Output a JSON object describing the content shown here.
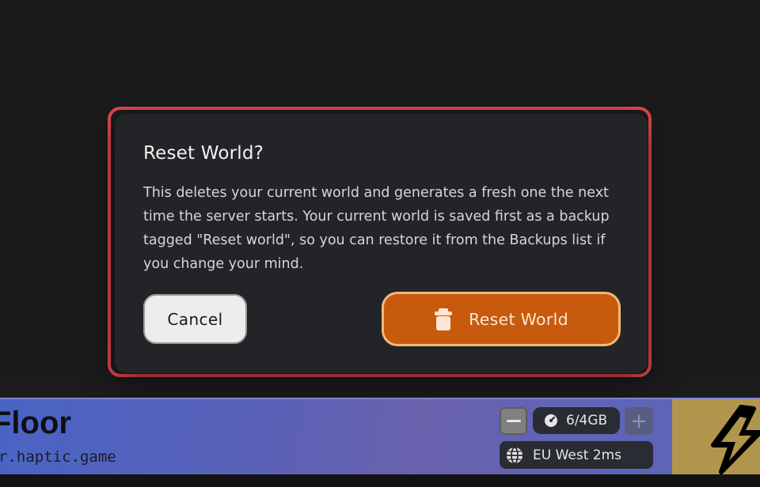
{
  "dialog": {
    "title": "Reset World?",
    "body": "This deletes your current world and generates a fresh one the next time the server starts. Your current world is saved first as a backup tagged \"Reset world\", so you can restore it from the Backups list if you change your mind.",
    "cancel_label": "Cancel",
    "confirm_label": "Reset World",
    "confirm_icon": "trash-icon"
  },
  "server": {
    "title": "Floor",
    "address": "r.haptic.game",
    "memory": "6/4GB",
    "memory_icon": "gauge-icon",
    "region": "EU West 2ms",
    "region_icon": "globe-icon",
    "power_icon": "lightning-icon"
  },
  "colors": {
    "danger_outline": "#e5484d",
    "confirm_button": "#c75a0d",
    "confirm_border": "#f4b77a",
    "power_panel": "#b2954c"
  }
}
